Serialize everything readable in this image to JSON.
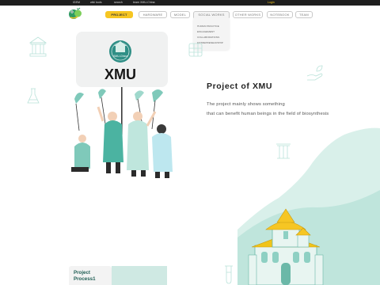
{
  "igem_bar": {
    "brand": "iGEM",
    "wiki_tools": "wiki tools",
    "search": "search",
    "team": "team XMU-China",
    "login": "Login"
  },
  "nav": {
    "items": [
      {
        "label": "PROJECT",
        "active": true
      },
      {
        "label": "HARDWARE"
      },
      {
        "label": "MODEL"
      },
      {
        "label": "SOCIAL WORKS"
      },
      {
        "label": "OTHER WORKS"
      },
      {
        "label": "NOTEBOOK"
      },
      {
        "label": "TEAM"
      }
    ],
    "dropdown": [
      "HUMAN PRACTICE",
      "ENGAGEMENT",
      "COLLABORATIONS",
      "ENTREPRENEURSHIP"
    ]
  },
  "hero": {
    "sign_text": "XMU",
    "badge_text": "XMU-China",
    "title": "Project of XMU",
    "line1": "The project mainly shows something",
    "line2": "that can benefit human beings in the field of biosynthesis"
  },
  "process": {
    "line1": "Project",
    "line2": "Process1"
  },
  "colors": {
    "accent": "#f6c623",
    "teal": "#8ed0c3",
    "teal_dark": "#3f9e8d",
    "mint": "#d9f0ea"
  }
}
